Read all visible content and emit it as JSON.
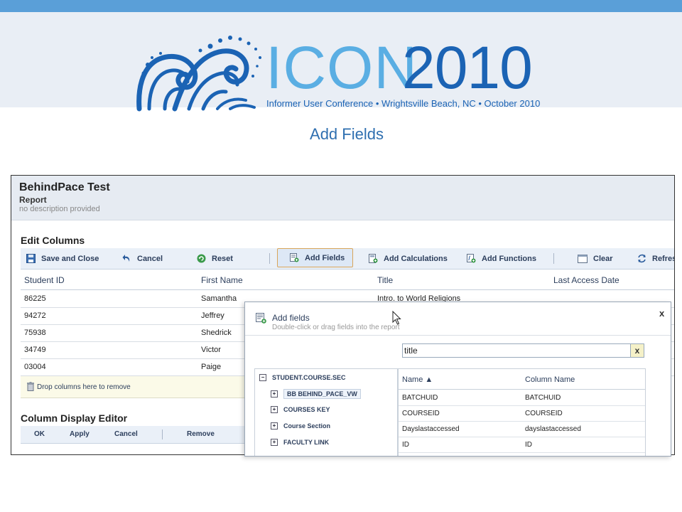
{
  "banner": {
    "logo_part1": "ICON",
    "logo_part2": "2010",
    "tagline": "Informer User Conference • Wrightsville Beach, NC • October 2010"
  },
  "slide": {
    "title": "Add Fields"
  },
  "report": {
    "name": "BehindPace Test",
    "type": "Report",
    "description": "no description provided"
  },
  "edit_columns": {
    "title": "Edit Columns",
    "toolbar": {
      "save_close": "Save and Close",
      "cancel": "Cancel",
      "reset": "Reset",
      "add_fields": "Add Fields",
      "add_calculations": "Add Calculations",
      "add_functions": "Add Functions",
      "clear": "Clear",
      "refresh": "Refresh S"
    },
    "columns": [
      "Student ID",
      "First Name",
      "Title",
      "Last Access Date"
    ],
    "rows": [
      {
        "id": "86225",
        "first": "Samantha",
        "title": "Intro. to World Religions"
      },
      {
        "id": "94272",
        "first": "Jeffrey"
      },
      {
        "id": "75938",
        "first": "Shedrick"
      },
      {
        "id": "34749",
        "first": "Victor"
      },
      {
        "id": "03004",
        "first": "Paige"
      }
    ],
    "drop_hint": "Drop columns here to remove"
  },
  "column_display_editor": {
    "title": "Column Display Editor",
    "ok": "OK",
    "apply": "Apply",
    "cancel": "Cancel",
    "remove": "Remove"
  },
  "dialog": {
    "title": "Add fields",
    "subtitle": "Double-click or drag fields into the report",
    "close": "x",
    "search_value": "title",
    "search_clear": "x",
    "tree": {
      "root": "STUDENT.COURSE.SEC",
      "children": [
        "BB BEHIND_PACE_VW",
        "COURSES KEY",
        "Course Section",
        "FACULTY LINK"
      ]
    },
    "grid": {
      "headers": [
        "Name ▲",
        "Column Name"
      ],
      "rows": [
        {
          "name": "BATCHUID",
          "column": "BATCHUID"
        },
        {
          "name": "COURSEID",
          "column": "COURSEID"
        },
        {
          "name": "Dayslastaccessed",
          "column": "dayslastaccessed"
        },
        {
          "name": "ID",
          "column": "ID"
        }
      ]
    }
  },
  "colors": {
    "top_bar": "#5a9fd8",
    "banner_bg": "#e9eef5",
    "logo_light": "#5aaee3",
    "logo_dark": "#1b63b4",
    "active_border": "#d9a55a"
  }
}
